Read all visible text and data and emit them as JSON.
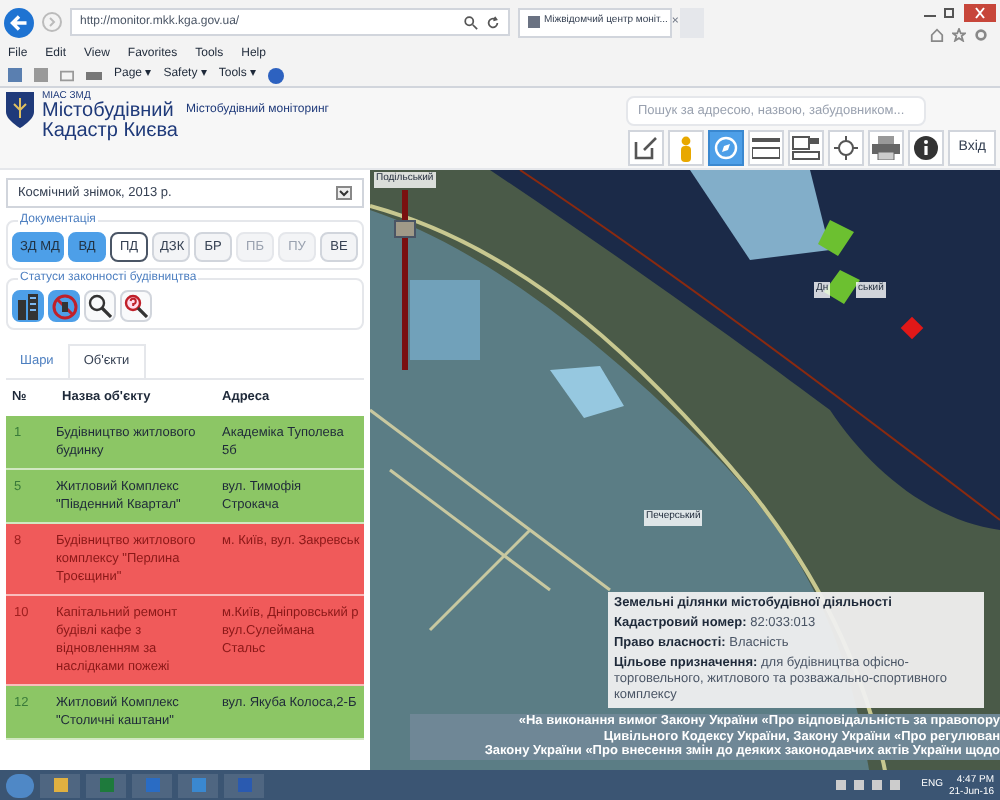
{
  "browser": {
    "url": "http://monitor.mkk.kga.gov.ua/",
    "tab_title": "Міжвідомчий центр моніт...",
    "tab_close": "×",
    "menu": [
      "File",
      "Edit",
      "View",
      "Favorites",
      "Tools",
      "Help"
    ],
    "command_bar": [
      "Page ▾",
      "Safety ▾",
      "Tools ▾"
    ]
  },
  "header": {
    "logo_caption": "МІАС ЗМД",
    "logo_title_1": "Містобудівний",
    "logo_title_2": "Кадастр Києва",
    "subtitle": "Містобудівний моніторинг",
    "search": {
      "placeholder": "Пошук за адресою, назвою, забудовником..."
    },
    "tools": [
      {
        "kind": "edit",
        "selected": false
      },
      {
        "kind": "person",
        "selected": false
      },
      {
        "kind": "compass",
        "selected": true
      },
      {
        "kind": "layers",
        "selected": false
      },
      {
        "kind": "panels",
        "selected": false
      },
      {
        "kind": "target",
        "selected": false
      },
      {
        "kind": "print",
        "selected": false
      },
      {
        "kind": "info",
        "selected": false
      }
    ],
    "login": "Вхід"
  },
  "sidebar": {
    "basemap": "Космічний знімок, 2013 р.",
    "documentation": {
      "title": "Документація",
      "buttons": [
        {
          "label": "ЗД МД",
          "selected": true,
          "disabled": false,
          "focused": false
        },
        {
          "label": "ВД",
          "selected": true,
          "disabled": false,
          "focused": false
        },
        {
          "label": "ПД",
          "selected": false,
          "disabled": false,
          "focused": true
        },
        {
          "label": "ДЗК",
          "selected": false,
          "disabled": false,
          "focused": false
        },
        {
          "label": "БР",
          "selected": false,
          "disabled": false,
          "focused": false
        },
        {
          "label": "ПБ",
          "selected": false,
          "disabled": true,
          "focused": false
        },
        {
          "label": "ПУ",
          "selected": false,
          "disabled": true,
          "focused": false
        },
        {
          "label": "ВЕ",
          "selected": false,
          "disabled": false,
          "focused": false
        }
      ]
    },
    "statuses": {
      "title": "Статуси законності будівництва",
      "buttons": [
        {
          "kind": "building",
          "selected": true
        },
        {
          "kind": "forbidden",
          "selected": true
        },
        {
          "kind": "search",
          "selected": false
        },
        {
          "kind": "question",
          "selected": false
        }
      ]
    },
    "tabs": [
      {
        "label": "Шари",
        "selected": false
      },
      {
        "label": "Об'єкти",
        "selected": true
      }
    ],
    "table": {
      "columns": [
        "№",
        "Назва об'єкту",
        "Адреса"
      ],
      "rows": [
        {
          "number": "1",
          "name": "Будівництво житлового будинку",
          "address": "Академіка Туполева 5б",
          "color": "#8cc665"
        },
        {
          "number": "5",
          "name": "Житловий Комплекс \"Південний Квартал\"",
          "address": "вул. Тимофія Строкача",
          "color": "#8cc665"
        },
        {
          "number": "8",
          "name": "Будівництво житлового комплексу \"Перлина Троєщини\"",
          "address": "м. Київ, вул. Закревськ",
          "color": "#f05a5a"
        },
        {
          "number": "10",
          "name": "Капітальний ремонт будівлі кафе з відновленням за наслідками пожежі",
          "address": "м.Київ, Дніпровський р вул.Сулеймана Стальс",
          "color": "#f05a5a"
        },
        {
          "number": "12",
          "name": "Житловий Комплекс \"Столичні каштани\"",
          "address": "вул. Якуба Колоса,2-Б",
          "color": "#8cc665"
        }
      ]
    }
  },
  "map": {
    "zoom_slider": {
      "level": 0.78
    },
    "labels": [
      "Подільський",
      "Дн",
      "ський",
      "Печерський"
    ],
    "popup": {
      "title": "Земельні ділянки містобудівної діяльності",
      "fields": [
        {
          "label": "Кадастровий номер:",
          "value": "82:033:013"
        },
        {
          "label": "Право власності:",
          "value": "Власність"
        },
        {
          "label": "Цільове призначення:",
          "value": "для будівництва офісно-торговельного, житлового та розважально-спортивного комплексу"
        }
      ]
    },
    "ticker": [
      "«На виконання вимог Закону України «Про відповідальність за правопору",
      "Цивільного Кодексу України, Закону України «Про регулюван",
      "Закону України «Про внесення змін до деяких законодавчих актів України щодо"
    ]
  },
  "taskbar": {
    "language": "ENG",
    "time": "4:47 PM",
    "date": "21-Jun-16"
  }
}
